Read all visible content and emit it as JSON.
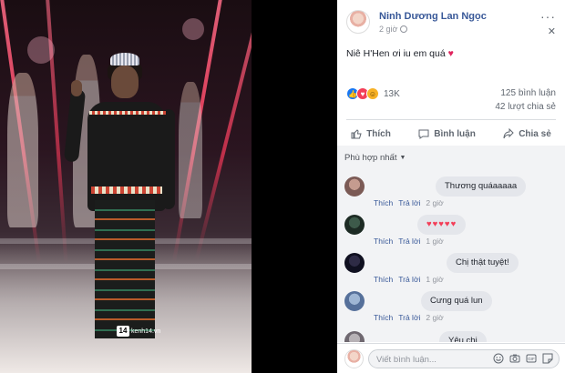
{
  "photo": {
    "watermark": "kenh14.vn",
    "watermark_logo": "14"
  },
  "post": {
    "author": "Ninh Dương Lan Ngọc",
    "time": "2 giờ",
    "text": "Niê H'Hen ơi iu em quá",
    "text_emoji": "♥",
    "reactions_count": "13K",
    "comments_count": "125 bình luận",
    "shares_count": "42 lượt chia sẻ"
  },
  "actions": {
    "like": "Thích",
    "comment": "Bình luận",
    "share": "Chia sẻ"
  },
  "comments": {
    "sort_label": "Phù hợp nhất",
    "items": [
      {
        "text": "Thương quáaaaaa",
        "like": "Thích",
        "reply": "Trả lời",
        "time": "2 giờ"
      },
      {
        "text": "♥♥♥♥♥",
        "like": "Thích",
        "reply": "Trả lời",
        "time": "1 giờ"
      },
      {
        "text": "Chị thật tuyệt!",
        "like": "Thích",
        "reply": "Trả lời",
        "time": "1 giờ"
      },
      {
        "text": "Cưng quá lun",
        "like": "Thích",
        "reply": "Trả lời",
        "time": "2 giờ"
      },
      {
        "text": "Yêu chị"
      }
    ]
  },
  "composer": {
    "placeholder": "Viết bình luận..."
  },
  "colors": {
    "link": "#385898",
    "reaction_like": "#1877f2",
    "reaction_love": "#f33e58",
    "reaction_haha": "#f7b125"
  }
}
